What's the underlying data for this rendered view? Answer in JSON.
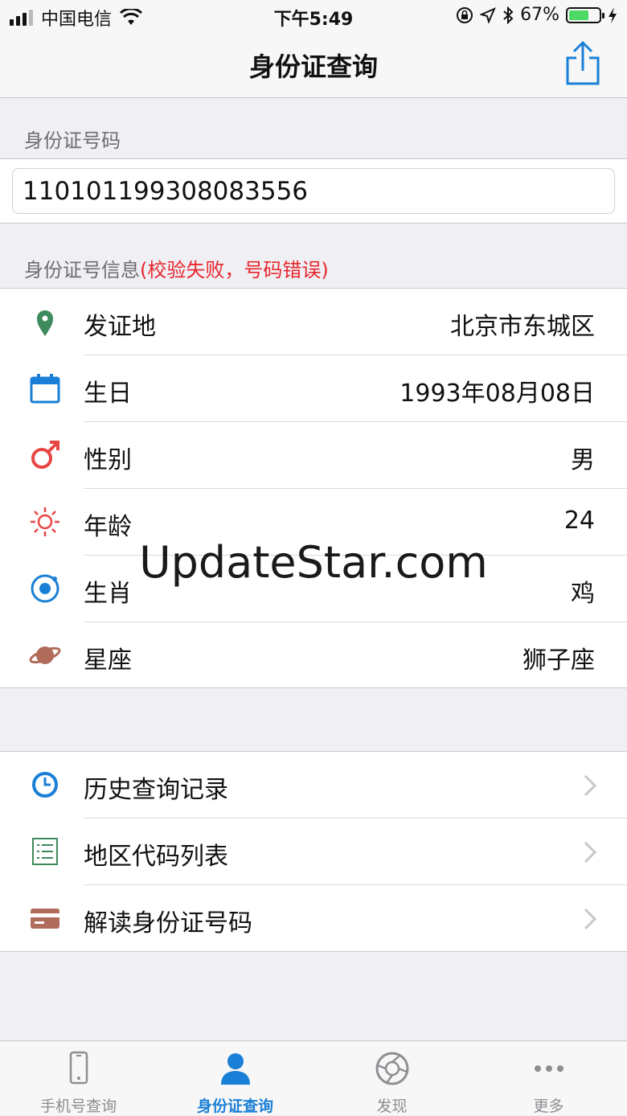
{
  "status_bar": {
    "carrier": "中国电信",
    "time": "下午5:49",
    "battery_percent": "67%",
    "battery_level": 0.67
  },
  "nav": {
    "title": "身份证查询"
  },
  "id_section": {
    "header": "身份证号码",
    "value": "110101199308083556"
  },
  "info_section": {
    "header": "身份证号信息",
    "status": "(校验失败，号码错误)",
    "status_color": "#e8262d",
    "rows": [
      {
        "label": "发证地",
        "value": "北京市东城区",
        "icon": "location-pin-icon"
      },
      {
        "label": "生日",
        "value": "1993年08月08日",
        "icon": "calendar-icon"
      },
      {
        "label": "性别",
        "value": "男",
        "icon": "male-symbol-icon"
      },
      {
        "label": "年龄",
        "value": "24",
        "icon": "sun-icon"
      },
      {
        "label": "生肖",
        "value": "鸡",
        "icon": "target-icon"
      },
      {
        "label": "星座",
        "value": "狮子座",
        "icon": "planet-icon"
      }
    ]
  },
  "menu": [
    {
      "label": "历史查询记录",
      "icon": "clock-icon"
    },
    {
      "label": "地区代码列表",
      "icon": "list-icon"
    },
    {
      "label": "解读身份证号码",
      "icon": "card-icon"
    }
  ],
  "tabs": [
    {
      "label": "手机号查询",
      "icon": "phone-icon",
      "active": false
    },
    {
      "label": "身份证查询",
      "icon": "person-icon",
      "active": true
    },
    {
      "label": "发现",
      "icon": "aperture-icon",
      "active": false
    },
    {
      "label": "更多",
      "icon": "more-dots-icon",
      "active": false
    }
  ],
  "watermark": "UpdateStar.com",
  "colors": {
    "accent": "#1a7fd6",
    "error": "#e8262d"
  }
}
